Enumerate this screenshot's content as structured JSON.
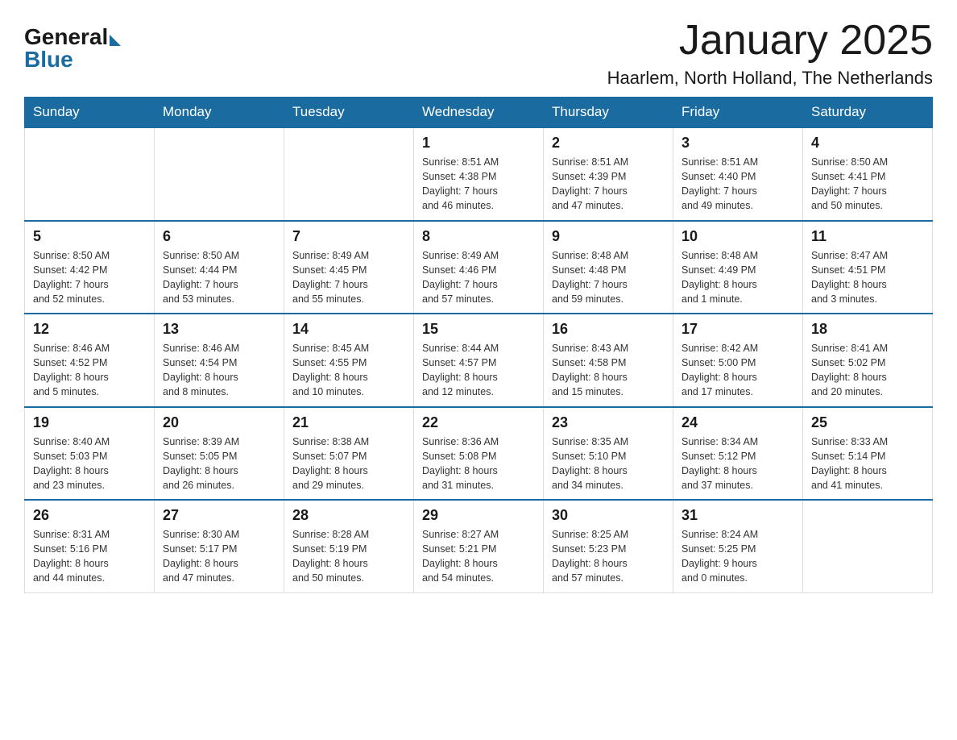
{
  "header": {
    "logo_general": "General",
    "logo_blue": "Blue",
    "month_title": "January 2025",
    "location": "Haarlem, North Holland, The Netherlands"
  },
  "days_of_week": [
    "Sunday",
    "Monday",
    "Tuesday",
    "Wednesday",
    "Thursday",
    "Friday",
    "Saturday"
  ],
  "weeks": [
    [
      {
        "day": "",
        "info": ""
      },
      {
        "day": "",
        "info": ""
      },
      {
        "day": "",
        "info": ""
      },
      {
        "day": "1",
        "info": "Sunrise: 8:51 AM\nSunset: 4:38 PM\nDaylight: 7 hours\nand 46 minutes."
      },
      {
        "day": "2",
        "info": "Sunrise: 8:51 AM\nSunset: 4:39 PM\nDaylight: 7 hours\nand 47 minutes."
      },
      {
        "day": "3",
        "info": "Sunrise: 8:51 AM\nSunset: 4:40 PM\nDaylight: 7 hours\nand 49 minutes."
      },
      {
        "day": "4",
        "info": "Sunrise: 8:50 AM\nSunset: 4:41 PM\nDaylight: 7 hours\nand 50 minutes."
      }
    ],
    [
      {
        "day": "5",
        "info": "Sunrise: 8:50 AM\nSunset: 4:42 PM\nDaylight: 7 hours\nand 52 minutes."
      },
      {
        "day": "6",
        "info": "Sunrise: 8:50 AM\nSunset: 4:44 PM\nDaylight: 7 hours\nand 53 minutes."
      },
      {
        "day": "7",
        "info": "Sunrise: 8:49 AM\nSunset: 4:45 PM\nDaylight: 7 hours\nand 55 minutes."
      },
      {
        "day": "8",
        "info": "Sunrise: 8:49 AM\nSunset: 4:46 PM\nDaylight: 7 hours\nand 57 minutes."
      },
      {
        "day": "9",
        "info": "Sunrise: 8:48 AM\nSunset: 4:48 PM\nDaylight: 7 hours\nand 59 minutes."
      },
      {
        "day": "10",
        "info": "Sunrise: 8:48 AM\nSunset: 4:49 PM\nDaylight: 8 hours\nand 1 minute."
      },
      {
        "day": "11",
        "info": "Sunrise: 8:47 AM\nSunset: 4:51 PM\nDaylight: 8 hours\nand 3 minutes."
      }
    ],
    [
      {
        "day": "12",
        "info": "Sunrise: 8:46 AM\nSunset: 4:52 PM\nDaylight: 8 hours\nand 5 minutes."
      },
      {
        "day": "13",
        "info": "Sunrise: 8:46 AM\nSunset: 4:54 PM\nDaylight: 8 hours\nand 8 minutes."
      },
      {
        "day": "14",
        "info": "Sunrise: 8:45 AM\nSunset: 4:55 PM\nDaylight: 8 hours\nand 10 minutes."
      },
      {
        "day": "15",
        "info": "Sunrise: 8:44 AM\nSunset: 4:57 PM\nDaylight: 8 hours\nand 12 minutes."
      },
      {
        "day": "16",
        "info": "Sunrise: 8:43 AM\nSunset: 4:58 PM\nDaylight: 8 hours\nand 15 minutes."
      },
      {
        "day": "17",
        "info": "Sunrise: 8:42 AM\nSunset: 5:00 PM\nDaylight: 8 hours\nand 17 minutes."
      },
      {
        "day": "18",
        "info": "Sunrise: 8:41 AM\nSunset: 5:02 PM\nDaylight: 8 hours\nand 20 minutes."
      }
    ],
    [
      {
        "day": "19",
        "info": "Sunrise: 8:40 AM\nSunset: 5:03 PM\nDaylight: 8 hours\nand 23 minutes."
      },
      {
        "day": "20",
        "info": "Sunrise: 8:39 AM\nSunset: 5:05 PM\nDaylight: 8 hours\nand 26 minutes."
      },
      {
        "day": "21",
        "info": "Sunrise: 8:38 AM\nSunset: 5:07 PM\nDaylight: 8 hours\nand 29 minutes."
      },
      {
        "day": "22",
        "info": "Sunrise: 8:36 AM\nSunset: 5:08 PM\nDaylight: 8 hours\nand 31 minutes."
      },
      {
        "day": "23",
        "info": "Sunrise: 8:35 AM\nSunset: 5:10 PM\nDaylight: 8 hours\nand 34 minutes."
      },
      {
        "day": "24",
        "info": "Sunrise: 8:34 AM\nSunset: 5:12 PM\nDaylight: 8 hours\nand 37 minutes."
      },
      {
        "day": "25",
        "info": "Sunrise: 8:33 AM\nSunset: 5:14 PM\nDaylight: 8 hours\nand 41 minutes."
      }
    ],
    [
      {
        "day": "26",
        "info": "Sunrise: 8:31 AM\nSunset: 5:16 PM\nDaylight: 8 hours\nand 44 minutes."
      },
      {
        "day": "27",
        "info": "Sunrise: 8:30 AM\nSunset: 5:17 PM\nDaylight: 8 hours\nand 47 minutes."
      },
      {
        "day": "28",
        "info": "Sunrise: 8:28 AM\nSunset: 5:19 PM\nDaylight: 8 hours\nand 50 minutes."
      },
      {
        "day": "29",
        "info": "Sunrise: 8:27 AM\nSunset: 5:21 PM\nDaylight: 8 hours\nand 54 minutes."
      },
      {
        "day": "30",
        "info": "Sunrise: 8:25 AM\nSunset: 5:23 PM\nDaylight: 8 hours\nand 57 minutes."
      },
      {
        "day": "31",
        "info": "Sunrise: 8:24 AM\nSunset: 5:25 PM\nDaylight: 9 hours\nand 0 minutes."
      },
      {
        "day": "",
        "info": ""
      }
    ]
  ]
}
